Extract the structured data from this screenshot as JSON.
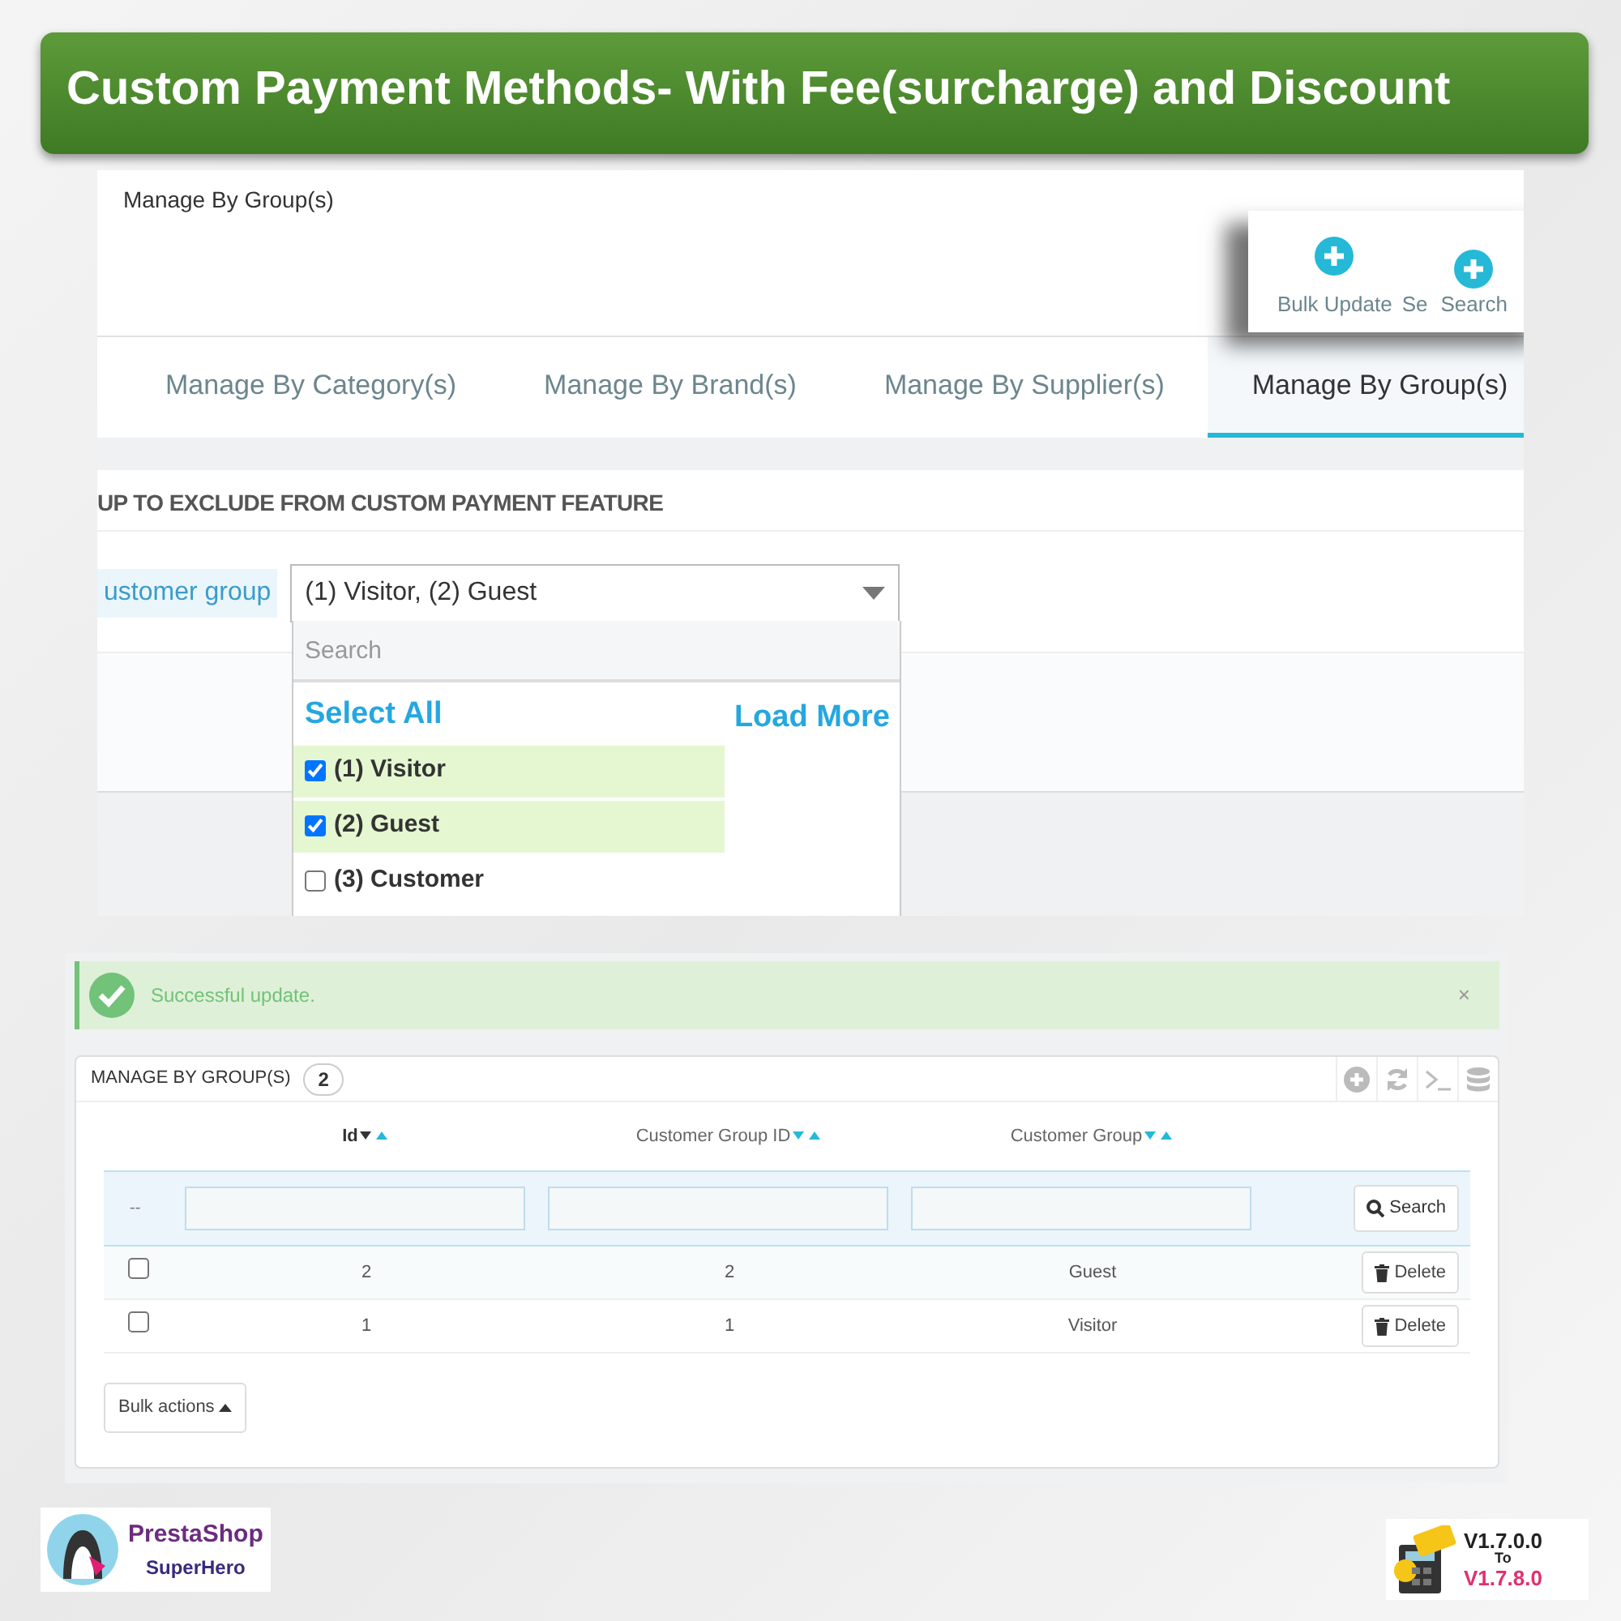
{
  "banner": {
    "title": "Custom Payment Methods- With Fee(surcharge) and Discount"
  },
  "config_screen": {
    "breadcrumb": "Manage By Group(s)",
    "toolbar": [
      {
        "kind": "button",
        "label": "Bulk Update"
      },
      {
        "kind": "text",
        "label": "Se"
      },
      {
        "kind": "button",
        "label": "Search"
      }
    ],
    "tabs": [
      {
        "label": "Manage By Category(s)",
        "selected": false
      },
      {
        "label": "Manage By Brand(s)",
        "selected": false
      },
      {
        "label": "Manage By Supplier(s)",
        "selected": false
      },
      {
        "label": "Manage By Group(s)",
        "selected": true
      }
    ],
    "section_title": "UP TO EXCLUDE FROM CUSTOM PAYMENT FEATURE",
    "field": {
      "label": "ustomer group",
      "value": "(1) Visitor, (2) Guest"
    },
    "dropdown": {
      "search": {
        "placeholder": "Search"
      },
      "select_all": "Select All",
      "load_more": "Load More",
      "options": [
        {
          "label": "(1) Visitor",
          "checked": true
        },
        {
          "label": "(2) Guest",
          "checked": true
        },
        {
          "label": "(3) Customer",
          "checked": false
        }
      ]
    }
  },
  "list_screen": {
    "alert": {
      "message": "Successful update.",
      "close": "×"
    },
    "panel": {
      "title": "MANAGE BY GROUP(S)",
      "count": "2",
      "columns": [
        {
          "label": "Id",
          "sorted": true
        },
        {
          "label": "Customer Group ID",
          "sorted": false
        },
        {
          "label": "Customer Group",
          "sorted": false
        }
      ],
      "filter_marker": "--",
      "search_button": "Search",
      "rows": [
        {
          "checked": false,
          "cells": [
            "2",
            "2",
            "Guest"
          ],
          "action": "Delete"
        },
        {
          "checked": false,
          "cells": [
            "1",
            "1",
            "Visitor"
          ],
          "action": "Delete"
        }
      ],
      "bulk_actions": "Bulk actions"
    }
  },
  "footer": {
    "brand": {
      "name": "PrestaShop",
      "tagline": "SuperHero"
    },
    "versions": {
      "from": "V1.7.0.0",
      "to_label": "To",
      "to": "V1.7.8.0"
    }
  }
}
